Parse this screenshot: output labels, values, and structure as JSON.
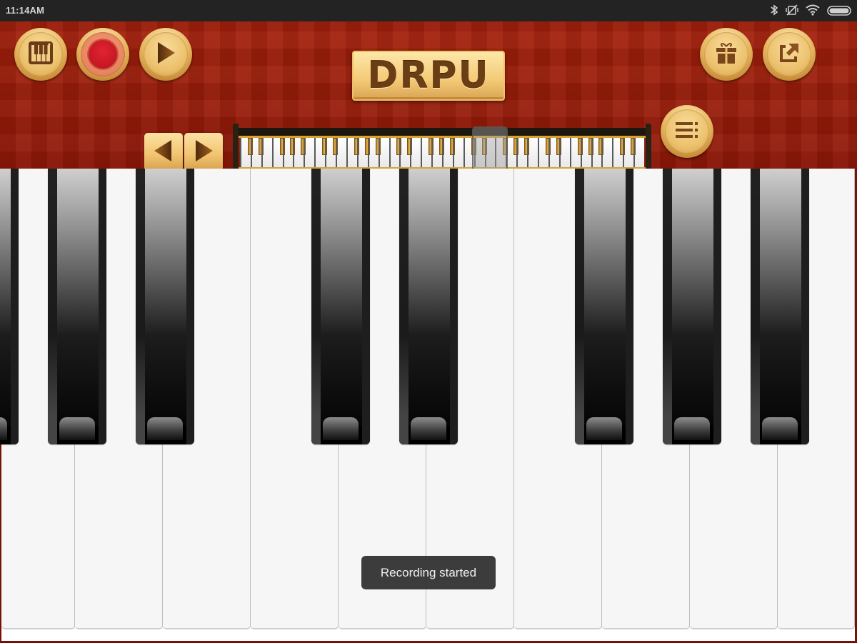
{
  "status_bar": {
    "time": "11:14AM",
    "icons": [
      "bluetooth-icon",
      "vibrate-off-icon",
      "wifi-icon",
      "battery-icon"
    ]
  },
  "header": {
    "logo_text": "DRPU",
    "left_buttons": [
      {
        "name": "keyboard-settings-button",
        "icon": "piano-keys-icon"
      },
      {
        "name": "record-button",
        "icon": "record-icon"
      },
      {
        "name": "play-button",
        "icon": "play-icon"
      }
    ],
    "right_buttons": [
      {
        "name": "gift-button",
        "icon": "gift-icon"
      },
      {
        "name": "share-button",
        "icon": "share-export-icon"
      }
    ],
    "scroll_left_icon": "triangle-left-icon",
    "scroll_right_icon": "triangle-right-icon",
    "menu_icon": "list-menu-icon"
  },
  "mini_keyboard": {
    "viewport_position_fraction": 0.63,
    "white_key_count": 38
  },
  "keyboard": {
    "visible_white_keys": 10,
    "black_key_pattern": [
      true,
      true,
      true,
      false,
      true,
      true,
      false,
      true,
      true,
      true
    ]
  },
  "toast": {
    "message": "Recording started"
  },
  "colors": {
    "header_red": "#a3200b",
    "gold": "#ecc16d",
    "record_red": "#d21c27",
    "toast_bg": "#323232"
  }
}
